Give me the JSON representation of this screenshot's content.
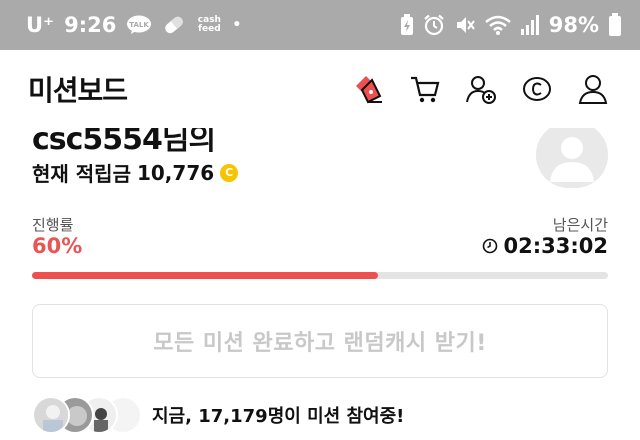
{
  "status_bar": {
    "carrier": "U⁺",
    "time": "9:26",
    "talk_icon_text": "TALK",
    "cashfeed_icon_text": "cash feed",
    "dot": "•",
    "battery_percent": "98%"
  },
  "header": {
    "title": "미션보드",
    "icons": [
      "mission-tag-icon",
      "cart-icon",
      "add-friend-icon",
      "coin-c-icon",
      "profile-icon"
    ]
  },
  "profile": {
    "username": "csc5554님의",
    "balance_label": "현재 적립금",
    "balance_value": "10,776",
    "coin_symbol": "C"
  },
  "progress": {
    "label": "진행률",
    "value_text": "60%",
    "fraction": 0.6,
    "remaining_label": "남은시간",
    "remaining_time": "02:33:02"
  },
  "claim_button": {
    "label": "모든 미션 완료하고 랜덤캐시 받기!"
  },
  "participants": {
    "prefix": "지금, ",
    "count": "17,179명",
    "suffix": "이 미션 참여중!"
  },
  "colors": {
    "accent": "#ee5050",
    "coin": "#f6c400",
    "status_bar": "#aaaaaa"
  }
}
